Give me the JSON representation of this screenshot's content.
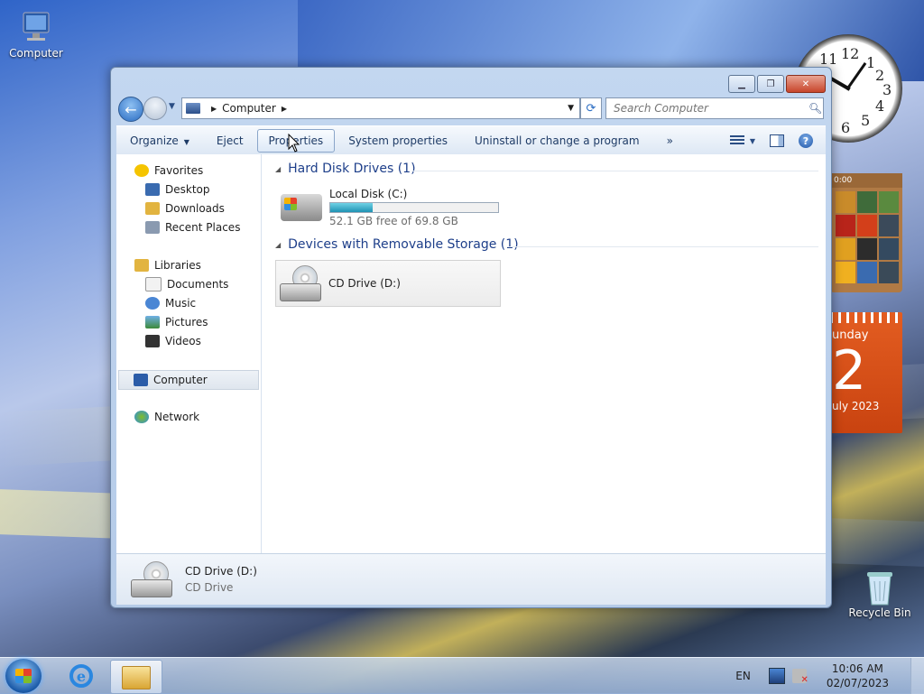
{
  "desktop": {
    "icons": [
      {
        "label": "Computer",
        "icon": "computer-icon"
      },
      {
        "label": "Recycle Bin",
        "icon": "recycle-bin-icon"
      }
    ]
  },
  "gadgets": {
    "clock": {
      "numbers": [
        "12",
        "1",
        "2",
        "3",
        "4",
        "5",
        "6",
        "11"
      ]
    },
    "puzzle": {
      "time": "0:00"
    },
    "calendar": {
      "weekday": "unday",
      "date": "2",
      "month_year": "uly 2023"
    }
  },
  "window": {
    "address": {
      "crumbs": [
        "Computer"
      ]
    },
    "search": {
      "placeholder": "Search Computer"
    },
    "toolbar": {
      "organize": "Organize",
      "eject": "Eject",
      "properties": "Properties",
      "system_properties": "System properties",
      "uninstall": "Uninstall or change a program",
      "more": "»"
    },
    "nav": {
      "favorites": "Favorites",
      "desktop": "Desktop",
      "downloads": "Downloads",
      "recent_places": "Recent Places",
      "libraries": "Libraries",
      "documents": "Documents",
      "music": "Music",
      "pictures": "Pictures",
      "videos": "Videos",
      "computer": "Computer",
      "network": "Network"
    },
    "groups": {
      "hdd": {
        "title": "Hard Disk Drives (1)"
      },
      "removable": {
        "title": "Devices with Removable Storage (1)"
      }
    },
    "drives": {
      "c": {
        "name": "Local Disk (C:)",
        "free_text": "52.1 GB free of 69.8 GB",
        "used_fraction": 0.254
      },
      "d": {
        "name": "CD Drive (D:)"
      }
    },
    "details": {
      "name": "CD Drive (D:)",
      "type": "CD Drive"
    }
  },
  "taskbar": {
    "language": "EN",
    "time": "10:06 AM",
    "date": "02/07/2023"
  },
  "colors": {
    "accent": "#1e3f8a",
    "progress": "#1f93b4",
    "calendar": "#c94310"
  }
}
